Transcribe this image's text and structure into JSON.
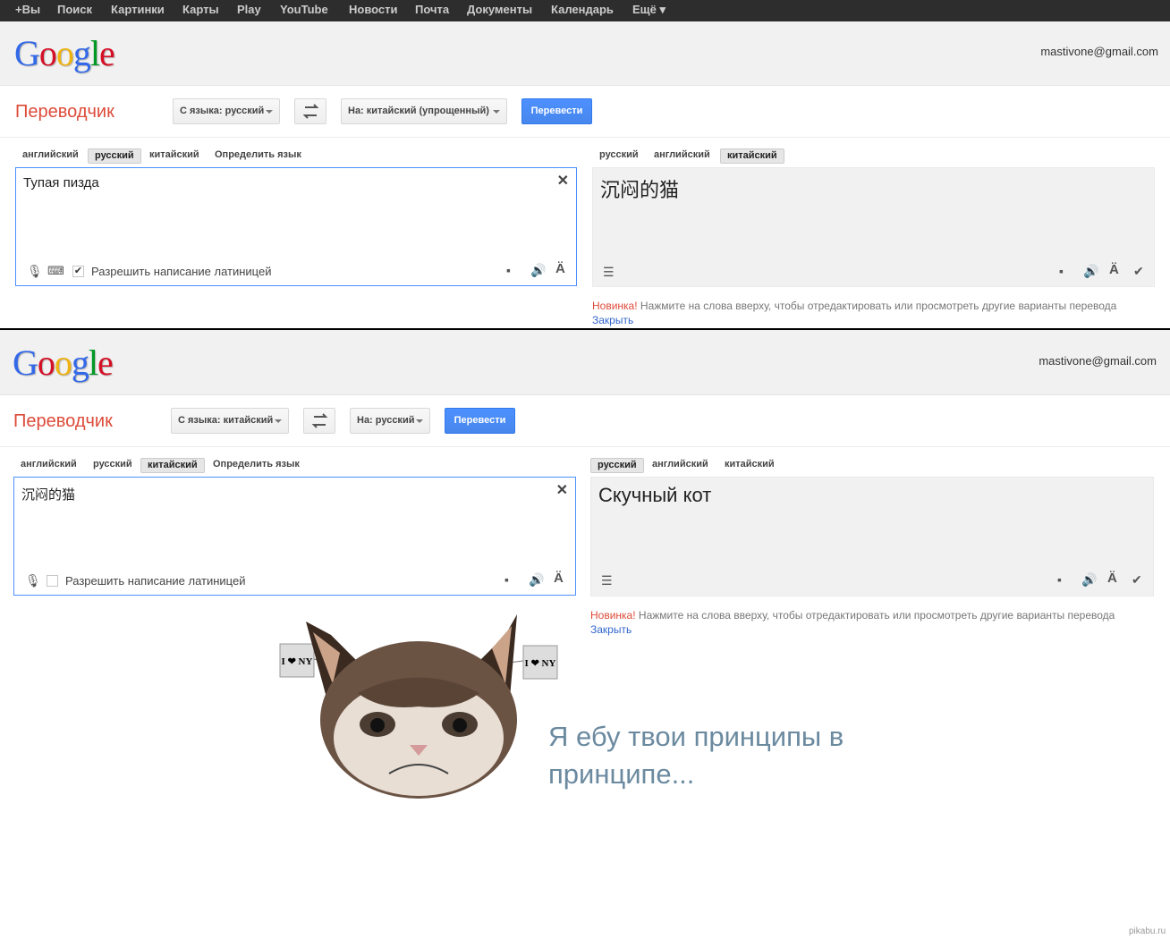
{
  "topnav": [
    "+Вы",
    "Поиск",
    "Картинки",
    "Карты",
    "Play",
    "YouTube",
    "Новости",
    "Почта",
    "Документы",
    "Календарь",
    "Ещё ▾"
  ],
  "logo": {
    "letters": [
      "G",
      "o",
      "o",
      "g",
      "l",
      "e"
    ],
    "colors": [
      "#3369e8",
      "#d50f25",
      "#eeb211",
      "#3369e8",
      "#009925",
      "#d50f25"
    ]
  },
  "account_email": "mastivone@gmail.com",
  "app_title": "Переводчик",
  "translate_btn": "Перевести",
  "allow_latin": "Разрешить написание латиницей",
  "notice": {
    "new": "Новинка!",
    "text": " Нажмите на слова вверху, чтобы отредактировать или просмотреть другие варианты перевода",
    "close": "Закрыть"
  },
  "screen1": {
    "from_lang": "С языка: русский",
    "to_lang": "На: китайский (упрощенный)",
    "src_tabs": [
      "английский",
      "русский",
      "китайский",
      "Определить язык"
    ],
    "res_tabs": [
      "русский",
      "английский",
      "китайский"
    ],
    "source_text": "Тупая пизда",
    "result_text": "沉闷的猫",
    "latin_checked": "✔"
  },
  "screen2": {
    "from_lang": "С языка: китайский",
    "to_lang": "На: русский",
    "src_tabs": [
      "английский",
      "русский",
      "китайский",
      "Определить язык"
    ],
    "res_tabs": [
      "русский",
      "английский",
      "китайский"
    ],
    "source_text": "沉闷的猫",
    "result_text": "Скучный кот",
    "latin_checked": ""
  },
  "meme_caption": "Я ебу твои принципы в принципе...",
  "cat_sign_text": "I ❤ NY",
  "watermark": "pikabu.ru"
}
